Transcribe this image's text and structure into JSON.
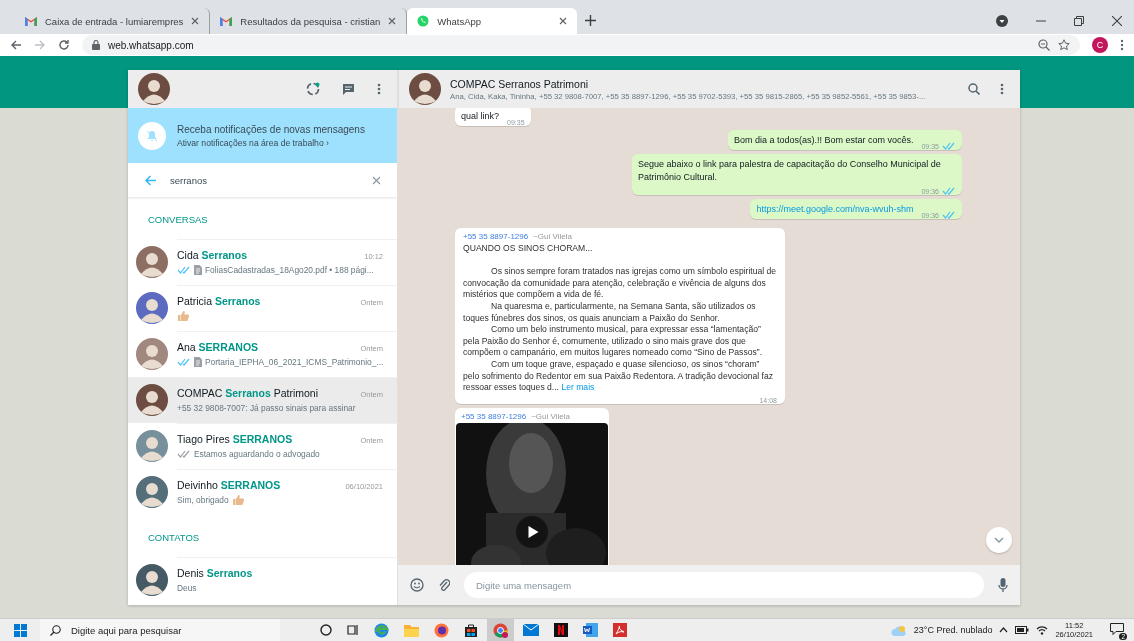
{
  "browser": {
    "tabs": [
      {
        "title": "Caixa de entrada - lumiarempres",
        "selected": false
      },
      {
        "title": "Resultados da pesquisa - cristian",
        "selected": false
      },
      {
        "title": "WhatsApp",
        "selected": true
      }
    ],
    "url": "web.whatsapp.com",
    "profile": "C"
  },
  "sidebar": {
    "notice": {
      "title": "Receba notificações de novas mensagens",
      "link": "Ativar notificações na área de trabalho ›"
    },
    "search": {
      "value": "serranos"
    },
    "sections": [
      {
        "title": "CONVERSAS",
        "items": [
          {
            "name": "Cida **Serranos**",
            "time": "10:12",
            "ticks": true,
            "read": true,
            "document": true,
            "thumb": false,
            "preview": "FoliasCadastradas_18Ago20.pdf • 188 pági...",
            "selected": false
          },
          {
            "name": "Patricia **Serranos**",
            "time": "Ontem",
            "ticks": false,
            "document": false,
            "thumb": true,
            "selected": false
          },
          {
            "name": "Ana **SERRANOS**",
            "time": "Ontem",
            "ticks": true,
            "read": true,
            "document": true,
            "thumb": false,
            "preview": "Portaria_IEPHA_06_2021_ICMS_Patrimonio_...",
            "selected": false
          },
          {
            "name": "COMPAC **Serranos** Patrimoni",
            "time": "Ontem",
            "ticks": false,
            "document": false,
            "thumb": false,
            "preview": "+55 32 9808-7007: Já passo sinais para assinar",
            "selected": true
          },
          {
            "name": "Tiago Pires **SERRANOS**",
            "time": "Ontem",
            "ticks": true,
            "read": false,
            "document": false,
            "thumb": false,
            "preview": "Estamos aguardando o advogado",
            "selected": false
          },
          {
            "name": "Deivinho **SERRANOS**",
            "time": "06/10/2021",
            "ticks": false,
            "document": false,
            "thumb": true,
            "preview": "Sim, obrigado",
            "selected": false
          }
        ]
      },
      {
        "title": "CONTATOS",
        "items": [
          {
            "name": "Denis **Serranos**",
            "ticks": false,
            "document": false,
            "thumb": false,
            "preview": "Deus",
            "selected": false
          }
        ]
      }
    ]
  },
  "chat": {
    "title": "COMPAC Serranos Patrimoni",
    "subtitle": "Ana, Cida, Kaka, Tininha, +55 32 9808-7007, +55 35 8897-1296, +55 35 9702-5393, +55 35 9815-2865, +55 35 9852-5561, +55 35 9853-...",
    "messages": [
      {
        "kind": "text",
        "outgoing": false,
        "text": "qual link?",
        "time": "09:35"
      },
      {
        "kind": "text",
        "outgoing": true,
        "text": "Bom dia a todos(as).!! Bom estar com vocês.",
        "time": "09:35",
        "read": true
      },
      {
        "kind": "text",
        "outgoing": true,
        "text": "Segue abaixo o link para palestra de capacitação do Conselho Municipal de Patrimônio Cultural.",
        "time": "09:36",
        "read": true
      },
      {
        "kind": "link",
        "outgoing": true,
        "text": "https://meet.google.com/nva-wvuh-shm",
        "time": "09:36",
        "read": true
      },
      {
        "kind": "post",
        "outgoing": false,
        "sender": "+55 35 8897-1296",
        "author": "~Gui Vilela",
        "title": "QUANDO OS SINOS CHORAM...",
        "paragraphs": [
          "Os sinos sempre foram tratados nas igrejas como um símbolo espiritual de convocação da comunidade para atenção, celebração e vivência de alguns dos mistérios que compõem a vida de fé.",
          "Na quaresma e, particularmente, na Semana Santa, são utilizados os toques fúnebres dos sinos, os quais anunciam a Paixão do Senhor.",
          "Como um belo instrumento musical, para expressar essa “lamentação” pela Paixão do Senhor é, comumente, utilizado o sino mais grave dos que compõem o campanário, em muitos lugares nomeado como “Sino de Passos”.",
          "Com um toque grave, espaçado e quase silencioso, os sinos “choram” pelo sofrimento do Redentor em sua Paixão Redentora. A tradição devocional faz ressoar esses toques d..."
        ],
        "more": "Ler mais",
        "time": "14:08"
      },
      {
        "kind": "video",
        "outgoing": false,
        "sender": "+55 35 8897-1296",
        "author": "~Gui Vilela"
      }
    ],
    "composer": {
      "placeholder": "Digite uma mensagem"
    }
  },
  "taskbar": {
    "search": {
      "placeholder": "Digite aqui para pesquisar"
    },
    "weather": "23°C Pred. nublado",
    "time": "11:52",
    "date": "26/10/2021",
    "notifications": "2"
  }
}
